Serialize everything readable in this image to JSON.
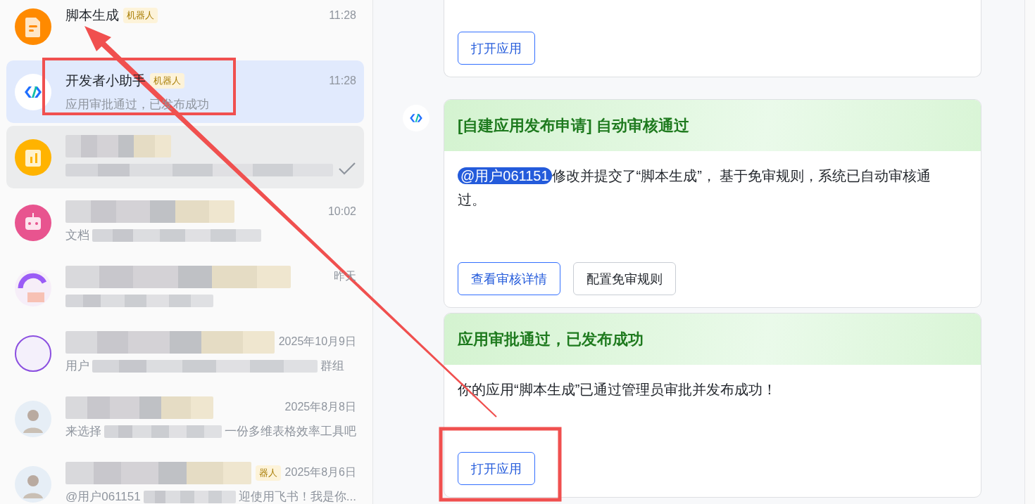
{
  "chat_list": [
    {
      "kind": "doc",
      "title": [
        {
          "kind": "text",
          "text": "脚本生成"
        }
      ],
      "tag": "机器人",
      "time": "11:28",
      "selected": false,
      "highlighted": false,
      "done": false
    },
    {
      "kind": "code",
      "title": [
        {
          "kind": "text",
          "text": "开发者小助手"
        }
      ],
      "tag": "机器人",
      "time": "11:28",
      "preview": [
        {
          "kind": "text",
          "text": "应用审批通过，已发布成功"
        }
      ],
      "selected": true,
      "highlighted": false,
      "done": false
    },
    {
      "kind": "chart",
      "title": [
        {
          "kind": "blur"
        }
      ],
      "preview": [
        {
          "kind": "blur"
        }
      ],
      "selected": false,
      "highlighted": true,
      "done": true
    },
    {
      "kind": "robot",
      "title": [
        {
          "kind": "blur"
        }
      ],
      "time": "10:02",
      "preview": [
        {
          "kind": "text",
          "text": "文档"
        },
        {
          "kind": "blur"
        }
      ],
      "selected": false,
      "highlighted": false,
      "done": false
    },
    {
      "kind": "ring",
      "title": [
        {
          "kind": "blur"
        }
      ],
      "time": "昨天",
      "preview": [
        {
          "kind": "blur"
        }
      ],
      "selected": false,
      "highlighted": false,
      "done": false
    },
    {
      "kind": "outline",
      "title": [
        {
          "kind": "blur"
        }
      ],
      "time": "2025年10月9日",
      "preview": [
        {
          "kind": "text",
          "text": "用户"
        },
        {
          "kind": "blur"
        },
        {
          "kind": "text",
          "text": "群组"
        }
      ],
      "selected": false,
      "highlighted": false,
      "done": false
    },
    {
      "kind": "person",
      "title": [
        {
          "kind": "blur"
        }
      ],
      "time": "2025年8月8日",
      "preview": [
        {
          "kind": "text",
          "text": "来选择"
        },
        {
          "kind": "blur"
        },
        {
          "kind": "text",
          "text": "一份多维表格效率工具吧"
        }
      ],
      "selected": false,
      "highlighted": false,
      "done": false
    },
    {
      "kind": "person",
      "title": [
        {
          "kind": "blur"
        }
      ],
      "tag": "器人",
      "time": "2025年8月6日",
      "preview": [
        {
          "kind": "text",
          "text": "@用户061151"
        },
        {
          "kind": "blur"
        },
        {
          "kind": "text",
          "text": "迎使用飞书！我是你..."
        }
      ],
      "selected": false,
      "highlighted": false,
      "done": false
    }
  ],
  "messages": [
    {
      "sender_avatar": false,
      "buttons": [
        {
          "label": "打开应用",
          "primary": true
        }
      ]
    },
    {
      "sender_avatar": true,
      "title": "[自建应用发布申请] 自动审核通过",
      "mention": "@用户061151",
      "body": "修改并提交了“脚本生成”， 基于免审规则，系统已自动审核通过。",
      "buttons": [
        {
          "label": "查看审核详情",
          "primary": true
        },
        {
          "label": "配置免审规则",
          "primary": false
        }
      ]
    },
    {
      "sender_avatar": false,
      "title": "应用审批通过，已发布成功",
      "body": "你的应用“脚本生成”已通过管理员审批并发布成功！",
      "buttons": [
        {
          "label": "打开应用",
          "primary": true
        }
      ]
    }
  ]
}
